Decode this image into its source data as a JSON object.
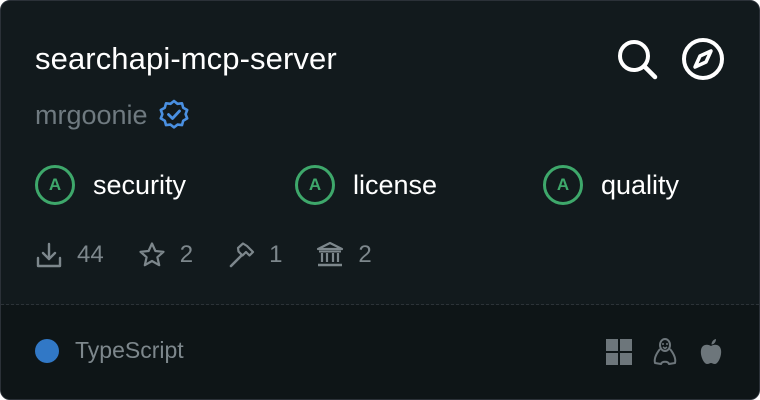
{
  "server": {
    "name": "searchapi-mcp-server",
    "author": "mrgoonie"
  },
  "grades": [
    {
      "grade": "A",
      "label": "security"
    },
    {
      "grade": "A",
      "label": "license"
    },
    {
      "grade": "A",
      "label": "quality"
    }
  ],
  "stats": {
    "downloads": "44",
    "stars": "2",
    "tools": "1",
    "institutions": "2"
  },
  "footer": {
    "language": "TypeScript",
    "language_color": "#3178c6",
    "platforms": [
      "windows-icon",
      "linux-icon",
      "apple-icon"
    ]
  },
  "colors": {
    "background": "#121a1d",
    "grade_green": "#3ea86b",
    "verified_blue": "#4a90e2"
  }
}
